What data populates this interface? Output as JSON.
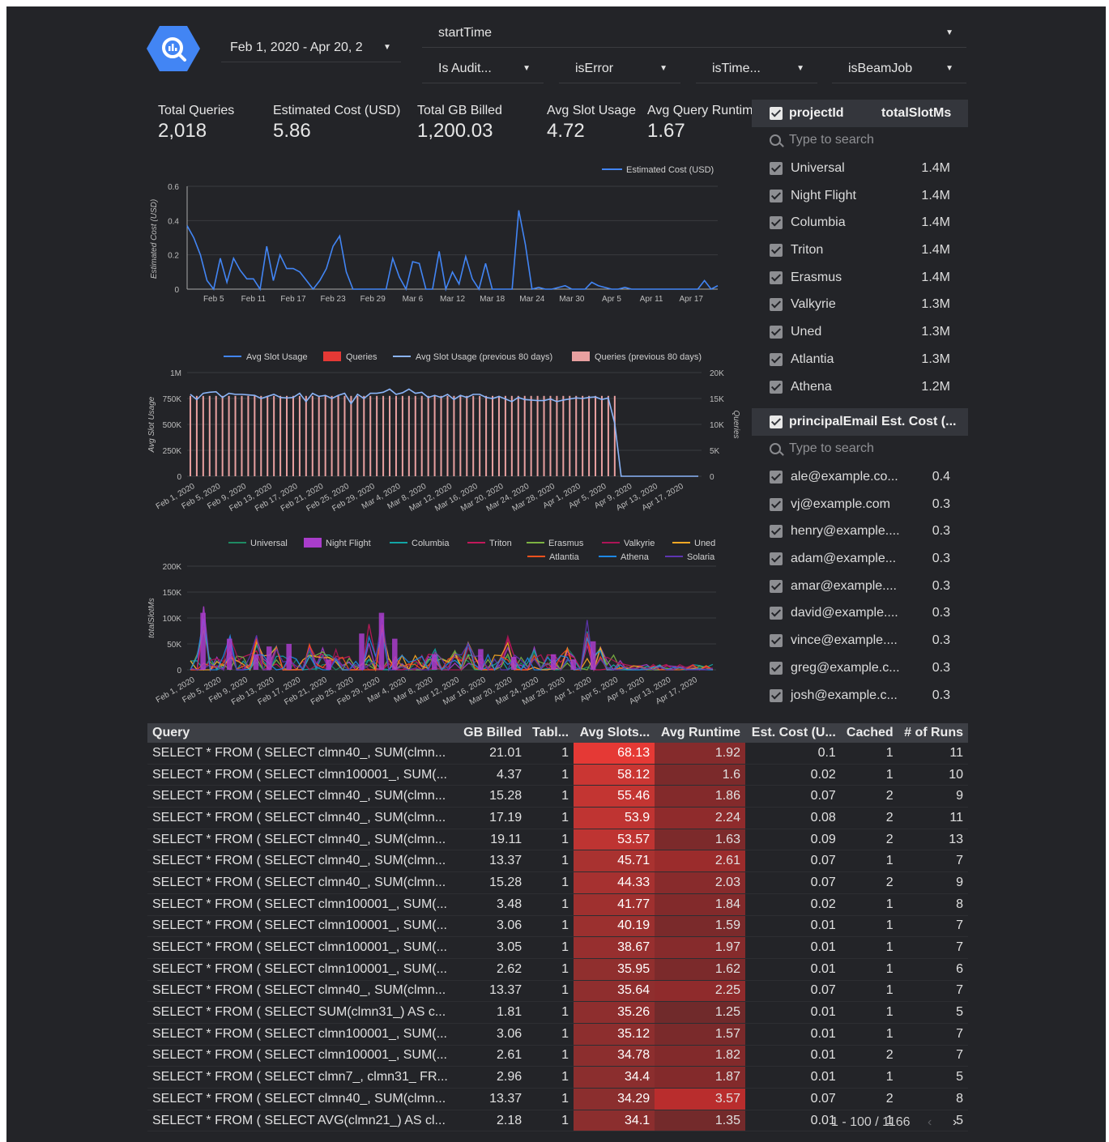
{
  "colors": {
    "background": "#232428",
    "accent": "#4285f4",
    "heat_high": "#e53935",
    "heat_low": "#4a2a2c"
  },
  "logo_icon": "bigquery-icon",
  "date_range": {
    "value": "Feb 1, 2020 - Apr 20, 2"
  },
  "filters": {
    "starttime": "startTime",
    "is_audit": "Is Audit...",
    "is_error": "isError",
    "is_time": "isTime...",
    "is_beam": "isBeamJob"
  },
  "kpis": [
    {
      "title": "Total Queries",
      "value": "2,018"
    },
    {
      "title": "Estimated Cost (USD)",
      "value": "5.86"
    },
    {
      "title": "Total GB Billed",
      "value": "1,200.03"
    },
    {
      "title": "Avg Slot Usage",
      "value": "4.72"
    },
    {
      "title": "Avg Query Runtime",
      "value": "1.67"
    }
  ],
  "project_panel": {
    "header_label": "projectId",
    "header_metric": "totalSlotMs",
    "search_placeholder": "Type to search",
    "items": [
      {
        "label": "Universal",
        "value": "1.4M"
      },
      {
        "label": "Night Flight",
        "value": "1.4M"
      },
      {
        "label": "Columbia",
        "value": "1.4M"
      },
      {
        "label": "Triton",
        "value": "1.4M"
      },
      {
        "label": "Erasmus",
        "value": "1.4M"
      },
      {
        "label": "Valkyrie",
        "value": "1.3M"
      },
      {
        "label": "Uned",
        "value": "1.3M"
      },
      {
        "label": "Atlantia",
        "value": "1.3M"
      },
      {
        "label": "Athena",
        "value": "1.2M"
      }
    ]
  },
  "email_panel": {
    "header_label": "principalEmail",
    "header_metric": "Est. Cost (...",
    "search_placeholder": "Type to search",
    "items": [
      {
        "label": "ale@example.co...",
        "value": "0.4"
      },
      {
        "label": "vj@example.com",
        "value": "0.3"
      },
      {
        "label": "henry@example....",
        "value": "0.3"
      },
      {
        "label": "adam@example...",
        "value": "0.3"
      },
      {
        "label": "amar@example....",
        "value": "0.3"
      },
      {
        "label": "david@example....",
        "value": "0.3"
      },
      {
        "label": "vince@example....",
        "value": "0.3"
      },
      {
        "label": "greg@example.c...",
        "value": "0.3"
      },
      {
        "label": "josh@example.c...",
        "value": "0.3"
      }
    ]
  },
  "chart_data": [
    {
      "type": "line",
      "series": [
        {
          "name": "Estimated Cost (USD)",
          "color": "#4285f4",
          "values": [
            0.37,
            0.3,
            0.2,
            0.05,
            0.0,
            0.18,
            0.04,
            0.18,
            0.11,
            0.06,
            0.06,
            0.0,
            0.25,
            0.05,
            0.2,
            0.12,
            0.12,
            0.1,
            0.05,
            0.0,
            0.05,
            0.12,
            0.25,
            0.31,
            0.1,
            0.0,
            0.0,
            0.0,
            0.0,
            0.0,
            0.0,
            0.18,
            0.07,
            0.0,
            0.16,
            0.15,
            0.0,
            0.0,
            0.22,
            0.0,
            0.1,
            0.03,
            0.19,
            0.06,
            0.0,
            0.15,
            0.0,
            0.0,
            0.0,
            0.0,
            0.46,
            0.26,
            0.0,
            0.01,
            0.0,
            0.0,
            0.01,
            0.02,
            0.0,
            0.0,
            0.0,
            0.04,
            0.02,
            0.01,
            0.0,
            0.0,
            0.01,
            0.0,
            0.0,
            0.0,
            0.0,
            0.0,
            0.0,
            0.0,
            0.0,
            0.0,
            0.0,
            0.0,
            0.05,
            0.0,
            0.02
          ]
        }
      ],
      "xticks": [
        "Feb 5",
        "Feb 11",
        "Feb 17",
        "Feb 23",
        "Feb 29",
        "Mar 6",
        "Mar 12",
        "Mar 18",
        "Mar 24",
        "Mar 30",
        "Apr 5",
        "Apr 11",
        "Apr 17"
      ],
      "ylabel": "Estimated Cost (USD)",
      "yticks": [
        "0",
        "0.2",
        "0.4",
        "0.6"
      ],
      "ylim": [
        0,
        0.6
      ],
      "legend": "top-right"
    },
    {
      "type": "bar",
      "series": [
        {
          "name": "Avg Slot Usage",
          "color": "#4285f4"
        },
        {
          "name": "Queries",
          "color": "#e53935"
        },
        {
          "name": "Avg Slot Usage (previous 80 days)",
          "color": "#8ab4f8",
          "values": [
            790000,
            740000,
            800000,
            810000,
            815000,
            760000,
            800000,
            790000,
            790000,
            785000,
            780000,
            750000,
            770000,
            790000,
            760000,
            755000,
            760000,
            800000,
            720000,
            800000,
            770000,
            780000,
            750000,
            780000,
            800000,
            700000,
            790000,
            750000,
            800000,
            800000,
            810000,
            840000,
            790000,
            805000,
            840000,
            800000,
            810000,
            760000,
            780000,
            760000,
            790000,
            740000,
            780000,
            760000,
            790000,
            790000,
            760000,
            750000,
            770000,
            745000,
            720000,
            760000,
            740000,
            735000,
            730000,
            730000,
            745000,
            720000,
            735000,
            745000,
            755000,
            750000,
            760000,
            765000,
            740000,
            755000,
            510000,
            0,
            0,
            0,
            0,
            0,
            0,
            0,
            0,
            0,
            0,
            0,
            0,
            0
          ]
        },
        {
          "name": "Queries (previous 80 days)",
          "color": "#e8a0a0",
          "values_constant": 15500,
          "bar_count": 67
        }
      ],
      "xticks": [
        "Feb 1, 2020",
        "Feb 5, 2020",
        "Feb 9, 2020",
        "Feb 13, 2020",
        "Feb 17, 2020",
        "Feb 21, 2020",
        "Feb 25, 2020",
        "Feb 29, 2020",
        "Mar 4, 2020",
        "Mar 8, 2020",
        "Mar 12, 2020",
        "Mar 16, 2020",
        "Mar 20, 2020",
        "Mar 24, 2020",
        "Mar 28, 2020",
        "Apr 1, 2020",
        "Apr 5, 2020",
        "Apr 9, 2020",
        "Apr 13, 2020",
        "Apr 17, 2020"
      ],
      "ylabel": "Avg Slot Usage",
      "yticks": [
        "0",
        "250K",
        "500K",
        "750K",
        "1M"
      ],
      "ylim": [
        0,
        1000000
      ],
      "y2label": "Queries",
      "y2ticks": [
        "0",
        "5K",
        "10K",
        "15K",
        "20K"
      ],
      "y2lim": [
        0,
        20000
      ],
      "legend": "top"
    },
    {
      "type": "bar",
      "series": [
        {
          "name": "Universal",
          "color": "#1e8a63"
        },
        {
          "name": "Night Flight",
          "color": "#a93dcb"
        },
        {
          "name": "Columbia",
          "color": "#12a5a5"
        },
        {
          "name": "Triton",
          "color": "#c2185b"
        },
        {
          "name": "Erasmus",
          "color": "#7cb342"
        },
        {
          "name": "Valkyrie",
          "color": "#ad1457"
        },
        {
          "name": "Uned",
          "color": "#f9a825"
        },
        {
          "name": "Atlantia",
          "color": "#f4511e"
        },
        {
          "name": "Athena",
          "color": "#1e88e5"
        },
        {
          "name": "Solaria",
          "color": "#5e35b1"
        }
      ],
      "xticks": [
        "Feb 1, 2020",
        "Feb 5, 2020",
        "Feb 9, 2020",
        "Feb 13, 2020",
        "Feb 17, 2020",
        "Feb 21, 2020",
        "Feb 25, 2020",
        "Feb 29, 2020",
        "Mar 4, 2020",
        "Mar 8, 2020",
        "Mar 12, 2020",
        "Mar 16, 2020",
        "Mar 20, 2020",
        "Mar 24, 2020",
        "Mar 28, 2020",
        "Apr 1, 2020",
        "Apr 5, 2020",
        "Apr 9, 2020",
        "Apr 13, 2020",
        "Apr 17, 2020"
      ],
      "ylabel": "totalSlotMs",
      "yticks": [
        "0",
        "50K",
        "100K",
        "150K",
        "200K"
      ],
      "ylim": [
        0,
        200000
      ],
      "legend": "top-right"
    }
  ],
  "table": {
    "headers": [
      "Query",
      "GB Billed",
      "Tabl...",
      "Avg Slots...",
      "Avg Runtime",
      "Est. Cost (U...",
      "Cached",
      "# of Runs"
    ],
    "rows": [
      [
        "SELECT * FROM ( SELECT clmn40_, SUM(clmn...",
        "21.01",
        "1",
        "68.13",
        "1.92",
        "0.1",
        "1",
        "11"
      ],
      [
        "SELECT * FROM ( SELECT clmn100001_, SUM(...",
        "4.37",
        "1",
        "58.12",
        "1.6",
        "0.02",
        "1",
        "10"
      ],
      [
        "SELECT * FROM ( SELECT clmn40_, SUM(clmn...",
        "15.28",
        "1",
        "55.46",
        "1.86",
        "0.07",
        "2",
        "9"
      ],
      [
        "SELECT * FROM ( SELECT clmn40_, SUM(clmn...",
        "17.19",
        "1",
        "53.9",
        "2.24",
        "0.08",
        "2",
        "11"
      ],
      [
        "SELECT * FROM ( SELECT clmn40_, SUM(clmn...",
        "19.11",
        "1",
        "53.57",
        "1.63",
        "0.09",
        "2",
        "13"
      ],
      [
        "SELECT * FROM ( SELECT clmn40_, SUM(clmn...",
        "13.37",
        "1",
        "45.71",
        "2.61",
        "0.07",
        "1",
        "7"
      ],
      [
        "SELECT * FROM ( SELECT clmn40_, SUM(clmn...",
        "15.28",
        "1",
        "44.33",
        "2.03",
        "0.07",
        "2",
        "9"
      ],
      [
        "SELECT * FROM ( SELECT clmn100001_, SUM(...",
        "3.48",
        "1",
        "41.77",
        "1.84",
        "0.02",
        "1",
        "8"
      ],
      [
        "SELECT * FROM ( SELECT clmn100001_, SUM(...",
        "3.06",
        "1",
        "40.19",
        "1.59",
        "0.01",
        "1",
        "7"
      ],
      [
        "SELECT * FROM ( SELECT clmn100001_, SUM(...",
        "3.05",
        "1",
        "38.67",
        "1.97",
        "0.01",
        "1",
        "7"
      ],
      [
        "SELECT * FROM ( SELECT clmn100001_, SUM(...",
        "2.62",
        "1",
        "35.95",
        "1.62",
        "0.01",
        "1",
        "6"
      ],
      [
        "SELECT * FROM ( SELECT clmn40_, SUM(clmn...",
        "13.37",
        "1",
        "35.64",
        "2.25",
        "0.07",
        "1",
        "7"
      ],
      [
        "SELECT * FROM ( SELECT SUM(clmn31_) AS c...",
        "1.81",
        "1",
        "35.26",
        "1.25",
        "0.01",
        "1",
        "5"
      ],
      [
        "SELECT * FROM ( SELECT clmn100001_, SUM(...",
        "3.06",
        "1",
        "35.12",
        "1.57",
        "0.01",
        "1",
        "7"
      ],
      [
        "SELECT * FROM ( SELECT clmn100001_, SUM(...",
        "2.61",
        "1",
        "34.78",
        "1.82",
        "0.01",
        "2",
        "7"
      ],
      [
        "SELECT * FROM ( SELECT clmn7_, clmn31_ FR...",
        "2.96",
        "1",
        "34.4",
        "1.87",
        "0.01",
        "1",
        "5"
      ],
      [
        "SELECT * FROM ( SELECT clmn40_, SUM(clmn...",
        "13.37",
        "1",
        "34.29",
        "3.57",
        "0.07",
        "2",
        "8"
      ],
      [
        "SELECT * FROM ( SELECT AVG(clmn21_) AS cl...",
        "2.18",
        "1",
        "34.1",
        "1.35",
        "0.01",
        "1",
        "5"
      ]
    ],
    "pagination": "1 - 100 / 1166"
  }
}
